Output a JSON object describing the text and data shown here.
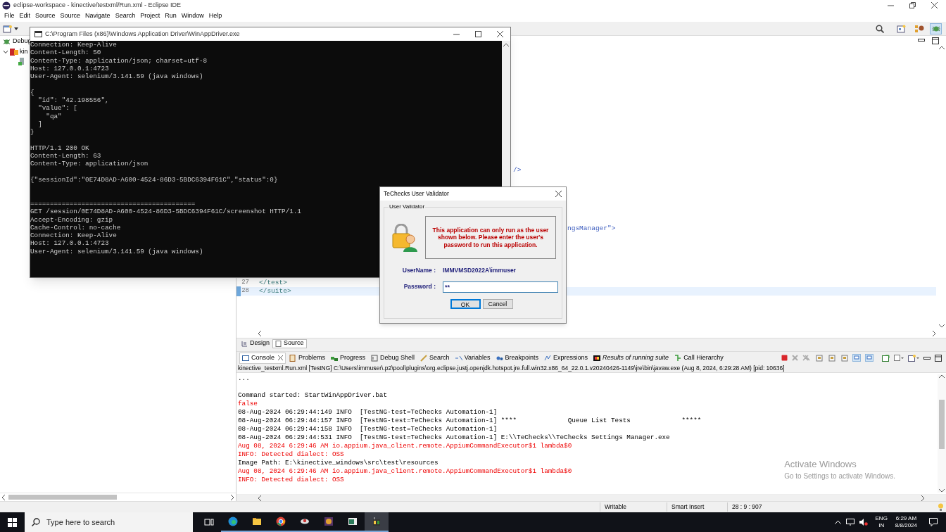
{
  "window": {
    "title": "eclipse-workspace - kinective/testxml/Run.xml - Eclipse IDE"
  },
  "menu": [
    "File",
    "Edit",
    "Source",
    "Source",
    "Navigate",
    "Search",
    "Project",
    "Run",
    "Window",
    "Help"
  ],
  "debug_view": {
    "tab": "Debug",
    "items": [
      {
        "label": "kin",
        "expanded": true
      }
    ]
  },
  "editor": {
    "fragments": [
      "/>",
      "ngsManager\">"
    ],
    "lines": [
      {
        "number": "27",
        "text": "</test>",
        "current": false
      },
      {
        "number": "28",
        "text": "</suite>",
        "current": true
      }
    ],
    "tabs": [
      {
        "label": "Design",
        "selected": false
      },
      {
        "label": "Source",
        "selected": true
      }
    ]
  },
  "console_window": {
    "title": "C:\\Program Files (x86)\\Windows Application Driver\\WinAppDriver.exe",
    "lines": [
      {
        "kind": "text",
        "text": "Connection: Keep-Alive"
      },
      {
        "kind": "text",
        "text": "Content-Length: 50"
      },
      {
        "kind": "text",
        "text": "Content-Type: application/json; charset=utf-8"
      },
      {
        "kind": "text",
        "text": "Host: 127.0.0.1:4723"
      },
      {
        "kind": "text",
        "text": "User-Agent: selenium/3.141.59 (java windows)"
      },
      {
        "kind": "blank"
      },
      {
        "kind": "text",
        "text": "{"
      },
      {
        "kind": "text",
        "text": "  \"id\": \"42.198556\","
      },
      {
        "kind": "text",
        "text": "  \"value\": ["
      },
      {
        "kind": "text",
        "text": "    \"qa\""
      },
      {
        "kind": "text",
        "text": "  ]"
      },
      {
        "kind": "text",
        "text": "}"
      },
      {
        "kind": "blank"
      },
      {
        "kind": "text",
        "text": "HTTP/1.1 200 OK"
      },
      {
        "kind": "text",
        "text": "Content-Length: 63"
      },
      {
        "kind": "text",
        "text": "Content-Type: application/json"
      },
      {
        "kind": "blank"
      },
      {
        "kind": "text",
        "text": "{\"sessionId\":\"0E74D8AD-A600-4524-86D3-5BDC6394F61C\",\"status\":0}"
      },
      {
        "kind": "blank"
      },
      {
        "kind": "blank"
      },
      {
        "kind": "text",
        "text": "=========================================="
      },
      {
        "kind": "text",
        "text": "GET /session/0E74D8AD-A600-4524-86D3-5BDC6394F61C/screenshot HTTP/1.1"
      },
      {
        "kind": "text",
        "text": "Accept-Encoding: gzip"
      },
      {
        "kind": "text",
        "text": "Cache-Control: no-cache"
      },
      {
        "kind": "text",
        "text": "Connection: Keep-Alive"
      },
      {
        "kind": "text",
        "text": "Host: 127.0.0.1:4723"
      },
      {
        "kind": "text",
        "text": "User-Agent: selenium/3.141.59 (java windows)"
      }
    ]
  },
  "dialog": {
    "title": "TeChecks User Validator",
    "group": "User Validator",
    "message": "This application can only run as the user shown below. Please enter the user's password to run this application.",
    "username_label": "UserName :",
    "username": "IMMVMSD2022A\\immuser",
    "password_label": "Password :",
    "password_value": "**",
    "buttons": [
      {
        "label": "OK",
        "default": true
      },
      {
        "label": "Cancel",
        "default": false
      }
    ]
  },
  "bottom_tabs": [
    {
      "label": "Console",
      "selected": true,
      "closable": true
    },
    {
      "label": "Problems",
      "selected": false
    },
    {
      "label": "Progress",
      "selected": false
    },
    {
      "label": "Debug Shell",
      "selected": false
    },
    {
      "label": "Search",
      "selected": false
    },
    {
      "label": "Variables",
      "selected": false
    },
    {
      "label": "Breakpoints",
      "selected": false
    },
    {
      "label": "Expressions",
      "selected": false
    },
    {
      "label": "Results of running suite",
      "selected": false
    },
    {
      "label": "Call Hierarchy",
      "selected": false
    }
  ],
  "console": {
    "header": "kinective_testxml.Run.xml [TestNG] C:\\Users\\immuser\\.p2\\pool\\plugins\\org.eclipse.justj.openjdk.hotspot.jre.full.win32.x86_64_22.0.1.v20240426-1149\\jre\\bin\\javaw.exe  (Aug 8, 2024, 6:29:28 AM) [pid: 10636]",
    "lines": [
      {
        "kind": "out",
        "text": "..."
      },
      {
        "kind": "blank"
      },
      {
        "kind": "out",
        "text": "Command started: StartWinAppDriver.bat"
      },
      {
        "kind": "err",
        "text": "false"
      },
      {
        "kind": "out",
        "text": "08-Aug-2024 06:29:44:149 INFO  [TestNG-test=TeChecks Automation-1]"
      },
      {
        "kind": "out",
        "text": "08-Aug-2024 06:29:44:157 INFO  [TestNG-test=TeChecks Automation-1] ****             Queue List Tests             *****"
      },
      {
        "kind": "out",
        "text": "08-Aug-2024 06:29:44:158 INFO  [TestNG-test=TeChecks Automation-1]"
      },
      {
        "kind": "out",
        "text": "08-Aug-2024 06:29:44:531 INFO  [TestNG-test=TeChecks Automation-1] E:\\\\TeChecks\\\\TeChecks Settings Manager.exe"
      },
      {
        "kind": "err",
        "text": "Aug 08, 2024 6:29:46 AM io.appium.java_client.remote.AppiumCommandExecutor$1 lambda$0"
      },
      {
        "kind": "err",
        "text": "INFO: Detected dialect: OSS"
      },
      {
        "kind": "out",
        "text": "Image Path: E:\\kinective_windows\\src\\test\\resources"
      },
      {
        "kind": "err",
        "text": "Aug 08, 2024 6:29:46 AM io.appium.java_client.remote.AppiumCommandExecutor$1 lambda$0"
      },
      {
        "kind": "err",
        "text": "INFO: Detected dialect: OSS"
      }
    ]
  },
  "activation": {
    "title": "Activate Windows",
    "subtitle": "Go to Settings to activate Windows."
  },
  "status_bar": [
    "Writable",
    "Smart Insert",
    "28 : 9 : 907"
  ],
  "taskbar": {
    "search_placeholder": "Type here to search",
    "language": "ENG",
    "region": "IN",
    "time": "6:29 AM",
    "date": "8/8/2024"
  }
}
